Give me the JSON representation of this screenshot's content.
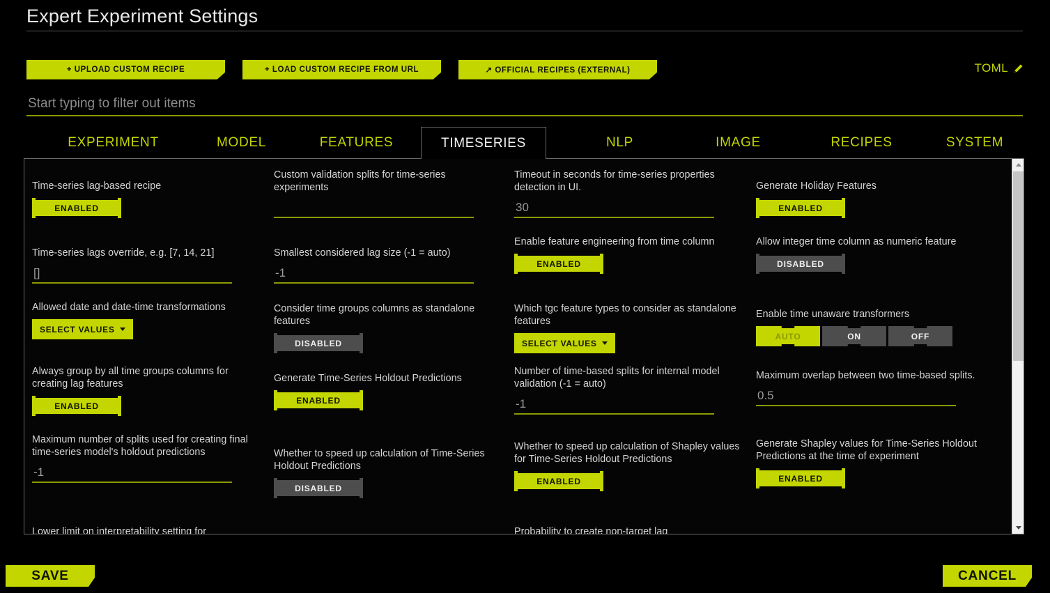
{
  "header": {
    "title": "Expert Experiment Settings",
    "toml_label": "TOML",
    "toml_icon": "pencil-icon"
  },
  "recipe_buttons": [
    {
      "label": "+ UPLOAD CUSTOM RECIPE"
    },
    {
      "label": "+ LOAD CUSTOM RECIPE FROM URL"
    },
    {
      "label": "↗ OFFICIAL RECIPES (EXTERNAL)"
    }
  ],
  "filter": {
    "value": "",
    "placeholder": "Start typing to filter out items"
  },
  "tabs": [
    {
      "label": "EXPERIMENT",
      "active": false
    },
    {
      "label": "MODEL",
      "active": false
    },
    {
      "label": "FEATURES",
      "active": false
    },
    {
      "label": "TIMESERIES",
      "active": true
    },
    {
      "label": "NLP",
      "active": false
    },
    {
      "label": "IMAGE",
      "active": false
    },
    {
      "label": "RECIPES",
      "active": false
    },
    {
      "label": "SYSTEM",
      "active": false
    }
  ],
  "columns": [
    {
      "settings": [
        {
          "label": "Time-series lag-based recipe",
          "control": "toggle",
          "state": "ENABLED"
        },
        {
          "label": "Time-series lags override, e.g. [7, 14, 21]",
          "control": "text",
          "value": "[]"
        },
        {
          "label": "Allowed date and date-time transformations",
          "control": "select",
          "value": "SELECT VALUES"
        },
        {
          "label": "Always group by all time groups columns for creating lag features",
          "control": "toggle",
          "state": "ENABLED"
        },
        {
          "label": "Maximum number of splits used for creating final time-series model's holdout predictions",
          "control": "text",
          "value": "-1"
        },
        {
          "label": "Lower limit on interpretability setting for",
          "control": "none"
        }
      ]
    },
    {
      "settings": [
        {
          "label": "Custom validation splits for time-series experiments",
          "control": "text",
          "value": ""
        },
        {
          "label": "Smallest considered lag size (-1 = auto)",
          "control": "text",
          "value": "-1"
        },
        {
          "label": "Consider time groups columns as standalone features",
          "control": "toggle",
          "state": "DISABLED"
        },
        {
          "label": "Generate Time-Series Holdout Predictions",
          "control": "toggle",
          "state": "ENABLED"
        },
        {
          "label": "Whether to speed up calculation of Time-Series Holdout Predictions",
          "control": "toggle",
          "state": "DISABLED"
        }
      ]
    },
    {
      "settings": [
        {
          "label": "Timeout in seconds for time-series properties detection in UI.",
          "control": "text",
          "value": "30"
        },
        {
          "label": "Enable feature engineering from time column",
          "control": "toggle",
          "state": "ENABLED"
        },
        {
          "label": "Which tgc feature types to consider as standalone features",
          "control": "select",
          "value": "SELECT VALUES"
        },
        {
          "label": "Number of time-based splits for internal model validation (-1 = auto)",
          "control": "text",
          "value": "-1"
        },
        {
          "label": "Whether to speed up calculation of Shapley values for Time-Series Holdout Predictions",
          "control": "toggle",
          "state": "ENABLED"
        },
        {
          "label": "Probability to create non-target lag",
          "control": "none"
        }
      ]
    },
    {
      "settings": [
        {
          "label": "Generate Holiday Features",
          "control": "toggle",
          "state": "ENABLED"
        },
        {
          "label": "Allow integer time column as numeric feature",
          "control": "toggle",
          "state": "DISABLED"
        },
        {
          "label": "Enable time unaware transformers",
          "control": "segmented",
          "options": [
            "AUTO",
            "ON",
            "OFF"
          ],
          "selected": "AUTO"
        },
        {
          "label": "Maximum overlap between two time-based splits.",
          "control": "text",
          "value": "0.5"
        },
        {
          "label": "Generate Shapley values for Time-Series Holdout Predictions at the time of experiment",
          "control": "toggle",
          "state": "ENABLED"
        }
      ]
    }
  ],
  "footer": {
    "save_label": "SAVE",
    "cancel_label": "CANCEL"
  },
  "colors": {
    "accent": "#c3d600",
    "background": "#000000",
    "disabled": "#4d4d4d",
    "text": "#d5d5d5"
  }
}
